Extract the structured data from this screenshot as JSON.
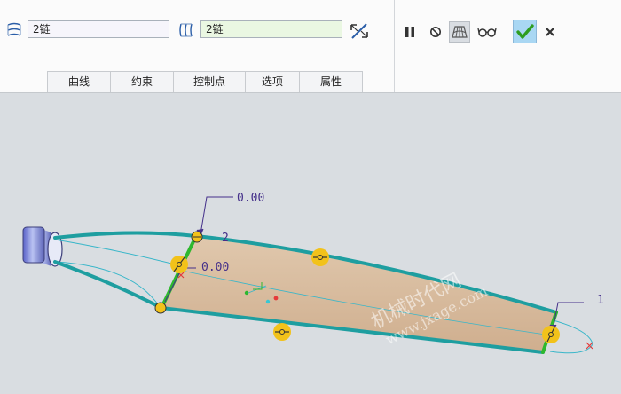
{
  "dashboard": {
    "first_collector_icon": "boundary-blend-first-direction-icon",
    "first_collector_value": "2链",
    "second_collector_icon": "boundary-blend-second-direction-icon",
    "second_collector_value": "2链",
    "swap_icon": "swap-arrows-icon",
    "tabs": [
      {
        "label": "曲线"
      },
      {
        "label": "约束"
      },
      {
        "label": "控制点"
      },
      {
        "label": "选项"
      },
      {
        "label": "属性"
      }
    ],
    "tools": {
      "pause_icon": "pause-icon",
      "no_preview_icon": "no-preview-icon",
      "preview_icon": "verify-preview-icon",
      "glasses_icon": "glasses-icon",
      "ok_icon": "checkmark-icon",
      "cancel_icon": "close-icon"
    },
    "accent": "#2e9d1f"
  },
  "graphics": {
    "dimension_top": "0.00",
    "dimension_mid": "0.00",
    "chain_label_2": "2",
    "chain_label_1": "1",
    "surface_color": "#d6b99c",
    "edge_color": "#1e9ea0",
    "handle_color": "#f2c21a",
    "watermark_cn": "机械时代网",
    "watermark_url": "www.jxage.com"
  }
}
